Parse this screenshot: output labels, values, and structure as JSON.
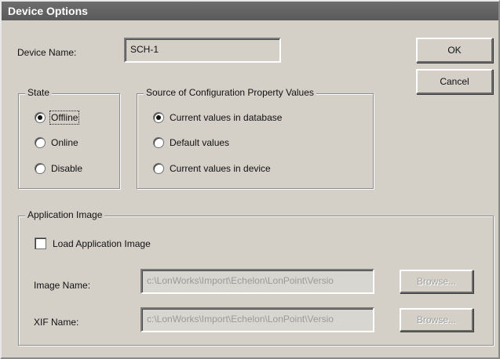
{
  "window": {
    "title": "Device Options"
  },
  "device_name": {
    "label": "Device Name:",
    "value": "SCH-1"
  },
  "buttons": {
    "ok": "OK",
    "cancel": "Cancel"
  },
  "state": {
    "title": "State",
    "options": [
      {
        "label": "Offline",
        "selected": true
      },
      {
        "label": "Online",
        "selected": false
      },
      {
        "label": "Disable",
        "selected": false
      }
    ]
  },
  "source": {
    "title": "Source of Configuration Property Values",
    "options": [
      {
        "label": "Current values in database",
        "selected": true
      },
      {
        "label": "Default values",
        "selected": false
      },
      {
        "label": "Current values in device",
        "selected": false
      }
    ]
  },
  "application_image": {
    "title": "Application Image",
    "load_label": "Load Application Image",
    "load_checked": false,
    "image_name": {
      "label": "Image Name:",
      "value": "c:\\LonWorks\\Import\\Echelon\\LonPoint\\Versio",
      "browse": "Browse..."
    },
    "xif_name": {
      "label": "XIF Name:",
      "value": "c:\\LonWorks\\Import\\Echelon\\LonPoint\\Versio",
      "browse": "Browse..."
    }
  }
}
